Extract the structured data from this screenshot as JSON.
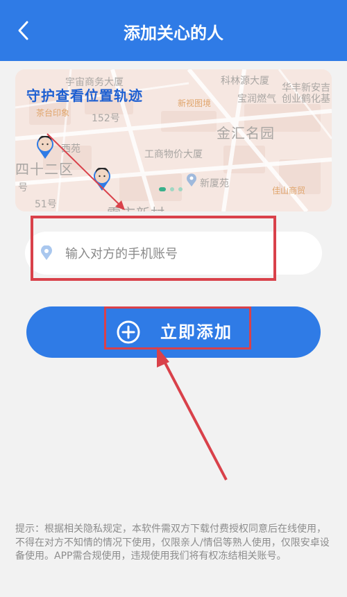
{
  "header": {
    "title": "添加关心的人",
    "back_icon": "chevron-left-icon"
  },
  "banner": {
    "title": "守护查看位置轨迹",
    "map_labels": {
      "l1": "宇宙商务大厦",
      "l2": "科林源大厦",
      "l3": "华丰新安吉",
      "l4": "宝润燃气",
      "l5": "创业鹤化基",
      "l6": "茶台印象",
      "l7": "新视图境",
      "l8": "152号",
      "l9": "金汇名园",
      "l10": "西苑",
      "l11": "四十二区",
      "l12": "工商物价大厦",
      "l13": "新厦苑",
      "l14": "号",
      "l15": "51号",
      "l16": "佳山商贸",
      "l17": "雪市新村"
    },
    "carousel": {
      "count": 3,
      "active": 1
    }
  },
  "phone_input": {
    "placeholder": "输入对方的手机账号",
    "value": "",
    "icon": "location-pin-icon"
  },
  "add_button": {
    "label": "立即添加",
    "icon": "plus-circle-icon"
  },
  "tip": "提示：根据相关隐私规定，本软件需双方下载付费授权同意后在线使用，不得在对方不知情的情况下使用，仅限亲人/情侣等熟人使用，仅限安卓设备使用。APP需合规使用，违规使用我们将有权冻结相关账号。",
  "colors": {
    "primary": "#2f7be6",
    "annotation": "#d9414a",
    "background": "#f2f2f2"
  }
}
